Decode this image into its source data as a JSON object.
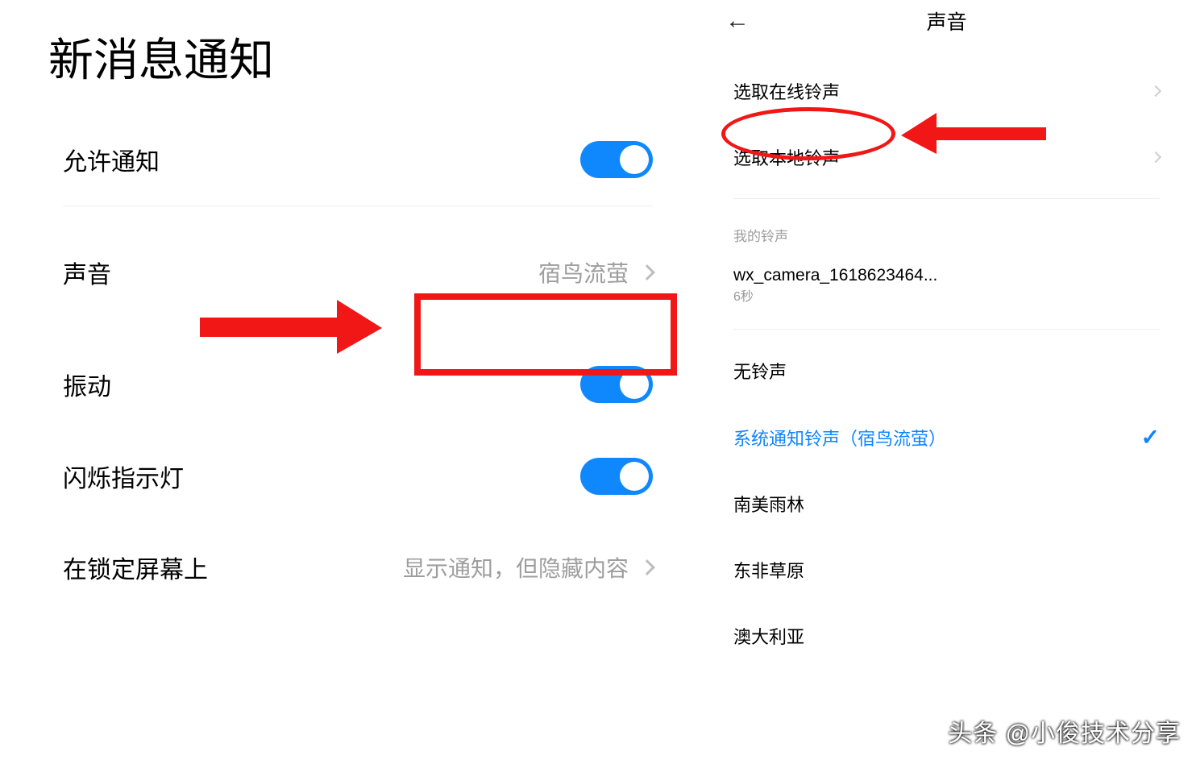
{
  "left": {
    "title": "新消息通知",
    "rows": {
      "allow": {
        "label": "允许通知",
        "on": true
      },
      "sound": {
        "label": "声音",
        "value": "宿鸟流萤"
      },
      "vibrate": {
        "label": "振动",
        "on": true
      },
      "led": {
        "label": "闪烁指示灯",
        "on": true
      },
      "lockscreen": {
        "label": "在锁定屏幕上",
        "value": "显示通知，但隐藏内容"
      }
    }
  },
  "right": {
    "back": "←",
    "title": "声音",
    "select_online": "选取在线铃声",
    "select_local": "选取本地铃声",
    "my_ringtones_label": "我的铃声",
    "my_ringtone_item": "wx_camera_1618623464...",
    "my_ringtone_duration": "6秒",
    "options": {
      "none": "无铃声",
      "system": "系统通知铃声（宿鸟流萤）",
      "rainforest": "南美雨林",
      "savanna": "东非草原",
      "australia": "澳大利亚"
    }
  },
  "watermark": "头条 @小俊技术分享"
}
